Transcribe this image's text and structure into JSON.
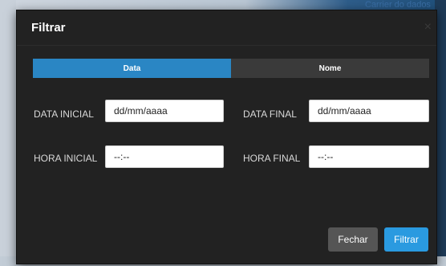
{
  "background": {
    "link_text": "Carrier do dados"
  },
  "modal": {
    "title": "Filtrar",
    "close_glyph": "×"
  },
  "tabs": [
    {
      "label": "Data",
      "active": true
    },
    {
      "label": "Nome",
      "active": false
    }
  ],
  "fields": {
    "data_inicial": {
      "label": "DATA INICIAL",
      "value": "dd/mm/aaaa"
    },
    "data_final": {
      "label": "DATA FINAL",
      "value": "dd/mm/aaaa"
    },
    "hora_inicial": {
      "label": "HORA INICIAL",
      "value": "--:--"
    },
    "hora_final": {
      "label": "HORA FINAL",
      "value": "--:--"
    }
  },
  "footer": {
    "close_label": "Fechar",
    "filter_label": "Filtrar"
  },
  "colors": {
    "accent": "#2a86c4",
    "primary_button": "#2a9ae0",
    "modal_bg": "#222222",
    "secondary_button": "#555555"
  }
}
